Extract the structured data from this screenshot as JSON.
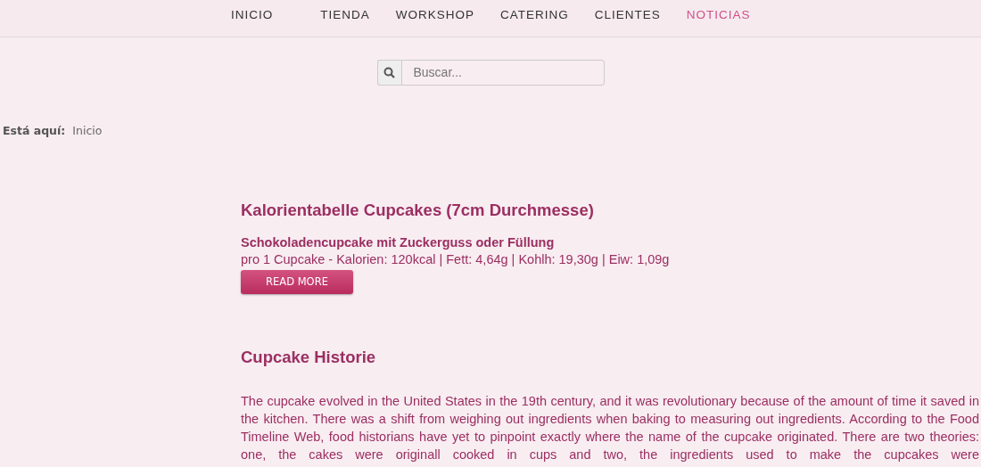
{
  "nav": [
    {
      "label": "INICIO",
      "selected": false
    },
    {
      "label": "TIENDA",
      "selected": false
    },
    {
      "label": "WORKSHOP",
      "selected": false
    },
    {
      "label": "CATERING",
      "selected": false
    },
    {
      "label": "CLIENTES",
      "selected": false
    },
    {
      "label": "NOTICIAS",
      "selected": true
    }
  ],
  "search": {
    "placeholder": "Buscar..."
  },
  "breadcrumb": {
    "label": "Está aquí:",
    "items": [
      "Inicio"
    ]
  },
  "articles": [
    {
      "title": "Kalorientabelle Cupcakes (7cm Durchmesse)",
      "subtitle": "Schokoladencupcake mit Zuckerguss oder Füllung",
      "text": "pro 1 Cupcake - Kalorien: 120kcal | Fett: 4,64g | Kohlh: 19,30g | Eiw: 1,09g",
      "button": "READ MORE"
    },
    {
      "title": "Cupcake Historie",
      "body": "The cupcake evolved in the United States in the 19th century, and it was revolutionary because of the amount of time it saved in the kitchen. There was a shift from weighing out ingredients when baking to measuring out ingredients. According to the Food Timeline Web, food historians have yet to pinpoint exactly where the name of the cupcake originated. There are two theories: one, the cakes were originall cooked in cups and two, the ingredients used to make the cupcakes were"
    }
  ]
}
